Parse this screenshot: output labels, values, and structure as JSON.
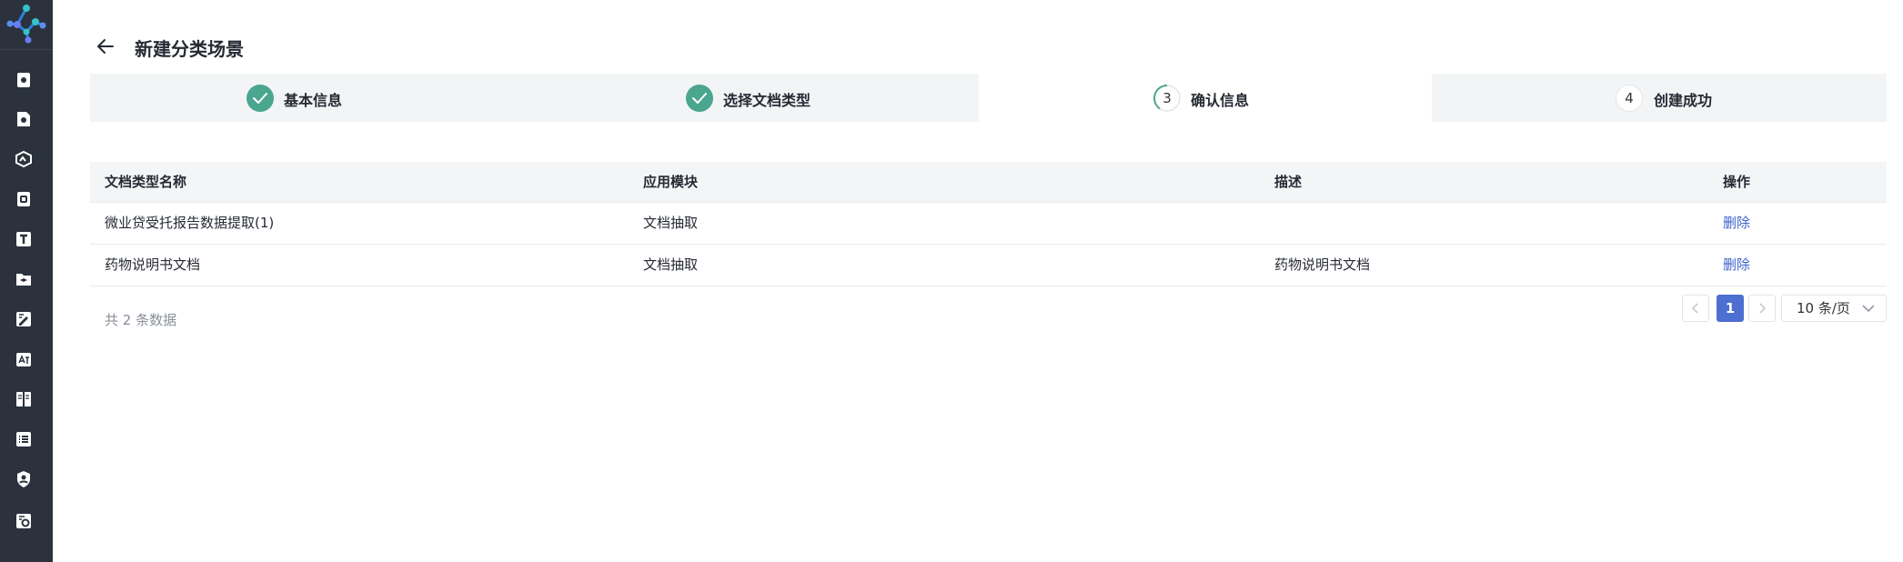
{
  "header": {
    "title": "新建分类场景"
  },
  "steps": [
    {
      "label": "基本信息",
      "status": "done"
    },
    {
      "label": "选择文档类型",
      "status": "done"
    },
    {
      "label": "确认信息",
      "status": "current",
      "number": "3"
    },
    {
      "label": "创建成功",
      "status": "pending",
      "number": "4"
    }
  ],
  "table": {
    "columns": [
      "文档类型名称",
      "应用模块",
      "描述",
      "操作"
    ],
    "rows": [
      {
        "name": "微业贷受托报告数据提取(1)",
        "module": "文档抽取",
        "desc": "",
        "action": "删除"
      },
      {
        "name": "药物说明书文档",
        "module": "文档抽取",
        "desc": "药物说明书文档",
        "action": "删除"
      }
    ]
  },
  "footer": {
    "total": "共 2 条数据"
  },
  "pagination": {
    "prev": "<",
    "current": "1",
    "next": ">",
    "page_size": "10 条/页"
  },
  "colors": {
    "accent": "#4aa68f",
    "link": "#3d63c9",
    "sidebar": "#2b323d"
  },
  "sidebar_icons": [
    "doc-scan-icon",
    "doc-settings-icon",
    "box-icon",
    "doc-check-icon",
    "text-icon",
    "folder-layers-icon",
    "edit-doc-icon",
    "translate-icon",
    "book-icon",
    "list-icon",
    "shield-user-icon",
    "settings-doc-icon"
  ]
}
